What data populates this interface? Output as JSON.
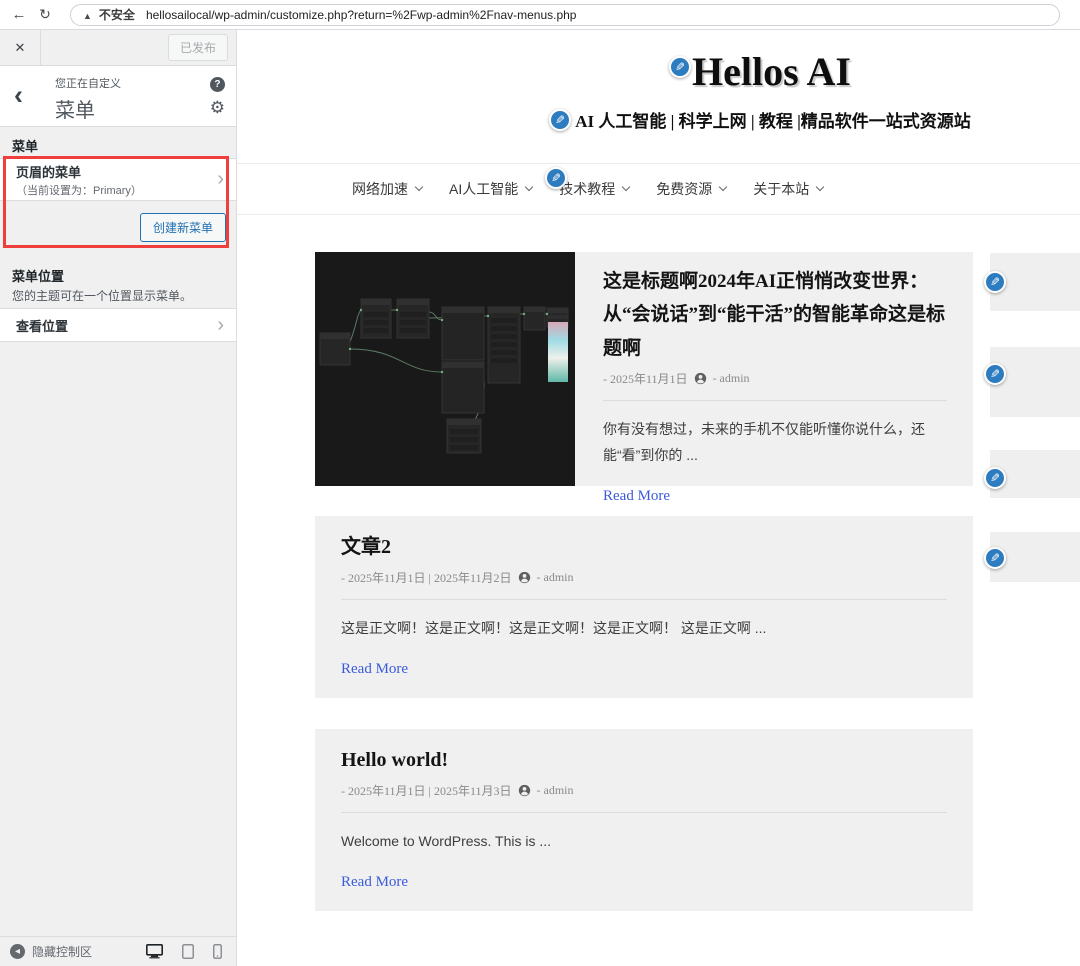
{
  "browser": {
    "security_label": "不安全",
    "url": "hellosailocal/wp-admin/customize.php?return=%2Fwp-admin%2Fnav-menus.php"
  },
  "customizer": {
    "publish_button_label": "已发布",
    "customizing_label": "您正在自定义",
    "panel_title": "菜单",
    "menus_section_label": "菜单",
    "header_menu": {
      "title": "页眉的菜单",
      "subtitle": "（当前设置为：Primary）"
    },
    "create_menu_button_label": "创建新菜单",
    "menu_locations": {
      "title": "菜单位置",
      "description": "您的主题可在一个位置显示菜单。",
      "view_locations_label": "查看位置"
    },
    "collapse_label": "隐藏控制区",
    "annotation_color": "#ee3f3d",
    "accent_color": "#2271b1"
  },
  "preview": {
    "site_title": "Hellos AI",
    "tagline": "AI 人工智能 | 科学上网 | 教程 |精品软件一站式资源站",
    "nav": [
      {
        "label": "网络加速"
      },
      {
        "label": "AI人工智能"
      },
      {
        "label": "技术教程"
      },
      {
        "label": "免费资源"
      },
      {
        "label": "关于本站"
      }
    ],
    "read_more_label": "Read More",
    "posts": [
      {
        "title": "这是标题啊2024年AI正悄悄改变世界：从“会说话”到“能干活”的智能革命这是标题啊",
        "date": "- 2025年11月1日",
        "author": "- admin",
        "excerpt": "你有没有想过，未来的手机不仅能听懂你说什么，还能“看”到你的 ...",
        "featured_image": "ComfyUI 节点工作流截图"
      },
      {
        "title": "文章2",
        "date": "- 2025年11月1日 | 2025年11月2日",
        "author": "- admin",
        "excerpt": "这是正文啊！这是正文啊！这是正文啊！这是正文啊！ 这是正文啊 ..."
      },
      {
        "title": "Hello world!",
        "date": "- 2025年11月1日 | 2025年11月3日",
        "author": "- admin",
        "excerpt": "Welcome to WordPress. This is ..."
      }
    ],
    "edit_icon_color": "#2e7cc0",
    "link_color": "#3b5bdb"
  }
}
